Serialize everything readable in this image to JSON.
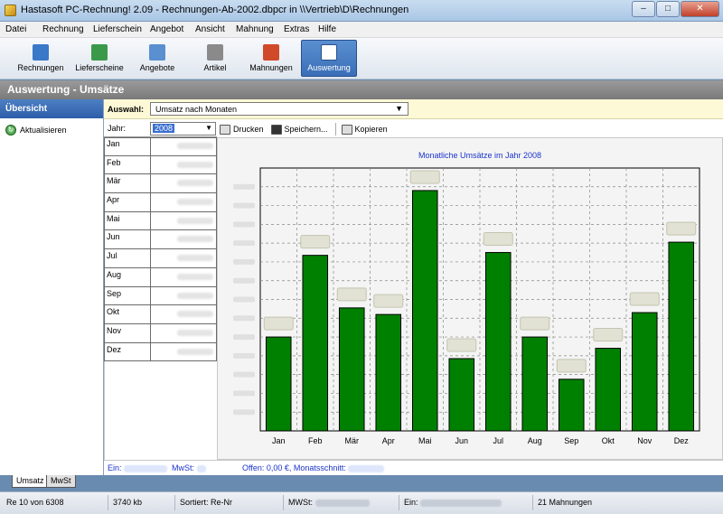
{
  "window": {
    "title": "Hastasoft PC-Rechnung! 2.09 - Rechnungen-Ab-2002.dbpcr in \\\\Vertrieb\\D\\Rechnungen",
    "min": "–",
    "max": "□",
    "close": "✕"
  },
  "menu": [
    {
      "label": "Datei"
    },
    {
      "label": "Rechnung"
    },
    {
      "label": "Lieferschein"
    },
    {
      "label": "Angebot"
    },
    {
      "label": "Ansicht"
    },
    {
      "label": "Mahnung"
    },
    {
      "label": "Extras"
    },
    {
      "label": "Hilfe"
    }
  ],
  "toolbar": [
    {
      "label": "Rechnungen",
      "icon": "invoice-icon",
      "color": "#3a78c8"
    },
    {
      "label": "Lieferscheine",
      "icon": "delivery-note-icon",
      "color": "#3a9a4a"
    },
    {
      "label": "Angebote",
      "icon": "offer-icon",
      "color": "#5a8fd0"
    },
    {
      "label": "Artikel",
      "icon": "article-icon",
      "color": "#8a8a8a"
    },
    {
      "label": "Mahnungen",
      "icon": "reminder-icon",
      "color": "#d04a2a"
    },
    {
      "label": "Auswertung",
      "icon": "chart-icon",
      "color": "#ffffff"
    }
  ],
  "section": {
    "title": "Auswertung - Umsätze"
  },
  "sidebar": {
    "header": "Übersicht",
    "refresh_label": "Aktualisieren"
  },
  "selection": {
    "label": "Auswahl:",
    "value": "Umsatz nach Monaten",
    "arrow": "▼"
  },
  "year": {
    "label": "Jahr:",
    "value": "2008",
    "arrow": "▼"
  },
  "actions": {
    "print": "Drucken",
    "save": "Speichern...",
    "copy": "Kopieren"
  },
  "months": [
    "Jan",
    "Feb",
    "Mär",
    "Apr",
    "Mai",
    "Jun",
    "Jul",
    "Aug",
    "Sep",
    "Okt",
    "Nov",
    "Dez"
  ],
  "chart_data": {
    "type": "bar",
    "title": "Monatliche Umsätze im Jahr 2008",
    "categories": [
      "Jan",
      "Feb",
      "Mär",
      "Apr",
      "Mai",
      "Jun",
      "Jul",
      "Aug",
      "Sep",
      "Okt",
      "Nov",
      "Dez"
    ],
    "values": [
      10,
      18.7,
      13.1,
      12.4,
      25.6,
      7.7,
      19.0,
      10.0,
      5.5,
      8.8,
      12.6,
      20.1
    ],
    "ylim": [
      0,
      28
    ],
    "grid": true,
    "bar_color": "#008000"
  },
  "info": {
    "ein": "Ein:",
    "mwst": "MwSt:",
    "offen": "Offen: 0,00 €, Monatsschnitt:"
  },
  "tabs": [
    {
      "label": "Umsatz"
    },
    {
      "label": "MwSt"
    }
  ],
  "status": {
    "record": "Re 10 von 6308",
    "size": "3740 kb",
    "sort": "Sortiert: Re-Nr",
    "mwst": "MWSt:",
    "ein": "Ein:",
    "mahnungen": "21 Mahnungen"
  }
}
